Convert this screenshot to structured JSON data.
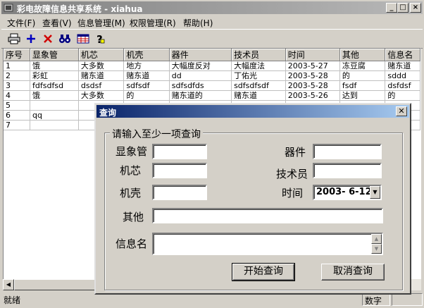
{
  "window": {
    "title": "彩电故障信息共享系统 - xiahua"
  },
  "menu": [
    "文件(F)",
    "查看(V)",
    "信息管理(M)",
    "权限管理(R)",
    "帮助(H)"
  ],
  "toolbar": {
    "icons": [
      "printer-icon",
      "add-icon",
      "delete-icon",
      "binoculars-icon",
      "table-icon",
      "help-icon"
    ]
  },
  "grid": {
    "columns": [
      "序号",
      "显象管",
      "机芯",
      "机壳",
      "器件",
      "技术员",
      "时间",
      "其他",
      "信息名"
    ],
    "rows": [
      [
        "1",
        "饿",
        "大多数",
        "地方",
        "大幅度反对",
        "大幅度法",
        "2003-5-27",
        "冻豆腐",
        "赌东道"
      ],
      [
        "2",
        "彩虹",
        "赌东道",
        "赌东道",
        "dd",
        "丁佑光",
        "2003-5-28",
        "的",
        "sddd"
      ],
      [
        "3",
        "fdfsdfsd",
        "dsdsf",
        "sdfsdf",
        "sdfsdfds",
        "sdfsdfsdf",
        "2003-5-28",
        "fsdf",
        "dsfdsf"
      ],
      [
        "4",
        "饿",
        "大多数",
        "的",
        "赌东道的",
        "赌东道",
        "2003-5-26",
        "达到",
        "的"
      ],
      [
        "5",
        "",
        "",
        "",
        "",
        "",
        "",
        "",
        ""
      ],
      [
        "6",
        "qq",
        "",
        "",
        "",
        "",
        "",
        "",
        ""
      ],
      [
        "7",
        "",
        "",
        "",
        "",
        "",
        "",
        "",
        ""
      ]
    ]
  },
  "status": {
    "left": "就绪",
    "right": "数字"
  },
  "dialog": {
    "title": "查询",
    "group_caption": "请输入至少一项查询",
    "labels": {
      "crt": "显象管",
      "chassis": "机芯",
      "case": "机壳",
      "other": "其他",
      "info_name": "信息名",
      "component": "器件",
      "technician": "技术员",
      "time": "时间"
    },
    "fields": {
      "crt": "",
      "chassis": "",
      "case": "",
      "other": "",
      "info_name": "",
      "component": "",
      "technician": "",
      "time": "2003- 6-12"
    },
    "buttons": {
      "start": "开始查询",
      "cancel": "取消查询"
    }
  }
}
